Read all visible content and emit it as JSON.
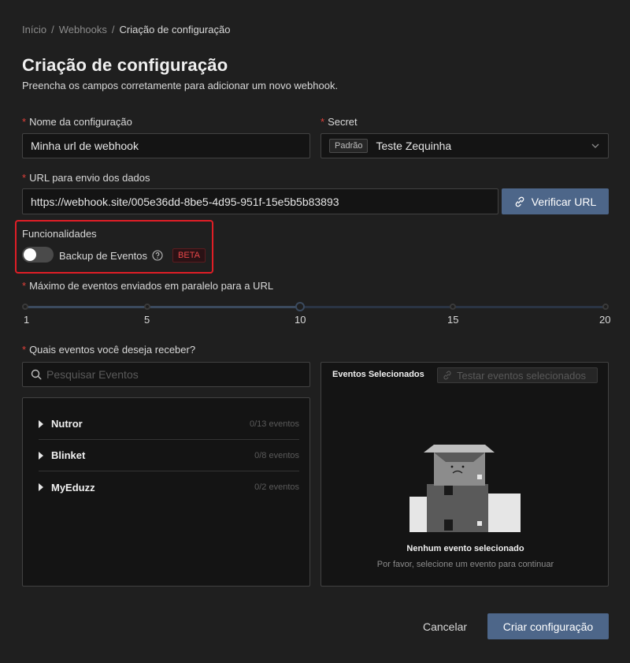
{
  "breadcrumb": {
    "items": [
      "Início",
      "Webhooks"
    ],
    "current": "Criação de configuração",
    "separator": "/"
  },
  "header": {
    "title": "Criação de configuração",
    "subtitle": "Preencha os campos corretamente para adicionar um novo webhook."
  },
  "form": {
    "name": {
      "label": "Nome da configuração",
      "value": "Minha url de webhook"
    },
    "secret": {
      "label": "Secret",
      "tag": "Padrão",
      "value": "Teste Zequinha"
    },
    "url": {
      "label": "URL para envio dos dados",
      "value": "https://webhook.site/005e36dd-8be5-4d95-951f-15e5b5b83893",
      "verify_label": "Verificar URL"
    },
    "features": {
      "label": "Funcionalidades",
      "backup_label": "Backup de Eventos",
      "beta_tag": "BETA",
      "backup_enabled": false
    },
    "parallel": {
      "label": "Máximo de eventos enviados em paralelo para a URL",
      "marks": [
        "1",
        "5",
        "10",
        "15",
        "20"
      ],
      "min": 1,
      "max": 20,
      "value": 10
    },
    "events": {
      "label": "Quais eventos você deseja receber?",
      "search_placeholder": "Pesquisar Eventos",
      "groups": [
        {
          "name": "Nutror",
          "count": "0/13 eventos"
        },
        {
          "name": "Blinket",
          "count": "0/8 eventos"
        },
        {
          "name": "MyEduzz",
          "count": "0/2 eventos"
        }
      ],
      "selected_title": "Eventos Selecionados",
      "test_label": "Testar eventos selecionados",
      "empty_title": "Nenhum evento selecionado",
      "empty_subtitle": "Por favor, selecione um evento para continuar"
    }
  },
  "footer": {
    "cancel_label": "Cancelar",
    "submit_label": "Criar configuração"
  },
  "colors": {
    "background": "#1f1f1f",
    "primary": "#4d6689",
    "required": "#e0413a",
    "highlight": "#e01e26"
  }
}
